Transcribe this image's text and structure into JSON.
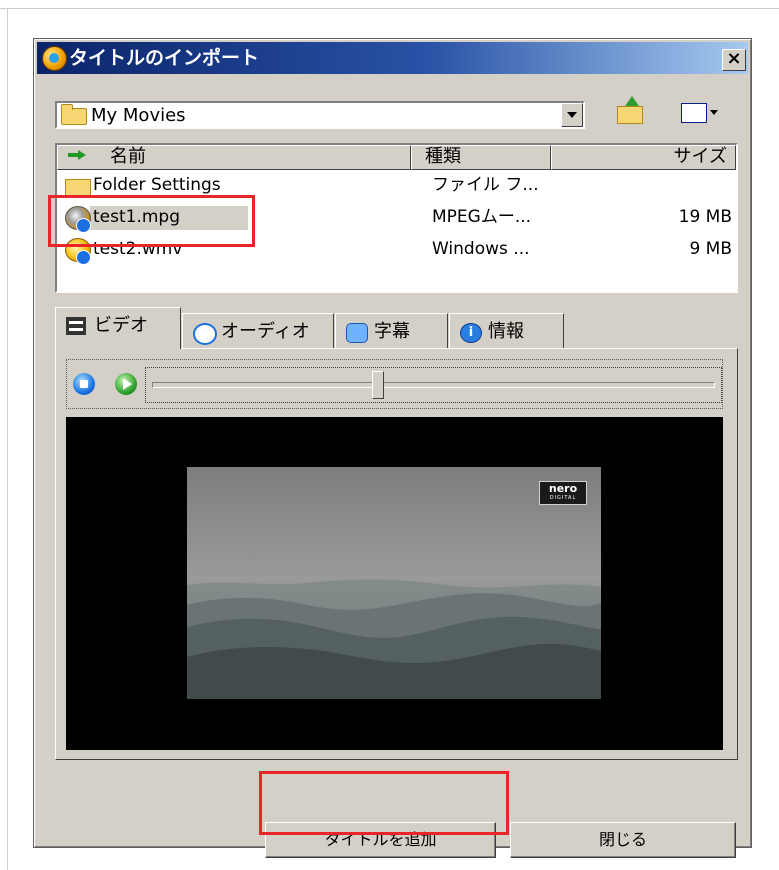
{
  "window": {
    "title": "タイトルのインポート"
  },
  "folder": {
    "current": "My Movies"
  },
  "columns": {
    "name": "名前",
    "type": "種類",
    "size": "サイズ"
  },
  "files": [
    {
      "name": "Folder Settings",
      "type": "ファイル フ...",
      "size": "",
      "icon": "folder-icon"
    },
    {
      "name": "test1.mpg",
      "type": "MPEGムー...",
      "size": "19 MB",
      "icon": "mpeg-disc-icon",
      "selected": true
    },
    {
      "name": "test2.wmv",
      "type": "Windows ...",
      "size": "9 MB",
      "icon": "wmv-media-icon"
    }
  ],
  "tabs": [
    {
      "label": "ビデオ",
      "icon": "film-icon",
      "active": true
    },
    {
      "label": "オーディオ",
      "icon": "audio-icon"
    },
    {
      "label": "字幕",
      "icon": "subtitle-icon"
    },
    {
      "label": "情報",
      "icon": "info-icon"
    }
  ],
  "player": {
    "seek_position": 0.4
  },
  "preview": {
    "logo_text": "nero",
    "logo_subtext": "DIGITAL"
  },
  "buttons": {
    "add_title": "タイトルを追加",
    "close": "閉じる"
  },
  "colors": {
    "titlebar": "#0a246a",
    "highlight": "#e8262a",
    "face": "#d4d0c8"
  }
}
